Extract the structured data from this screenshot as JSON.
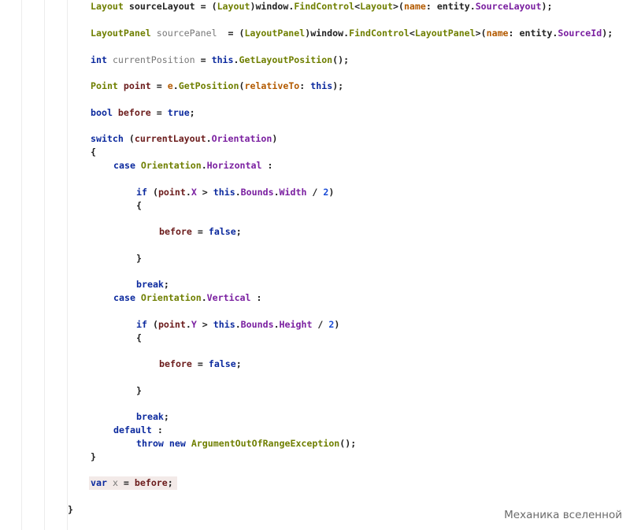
{
  "code_editor": {
    "lines": [
      [
        "Layout",
        " ",
        "sourceLayout",
        " = (",
        "Layout",
        ")",
        "window",
        ".",
        "FindControl",
        "<",
        "Layout",
        ">(",
        "name",
        ": ",
        "entity",
        ".",
        "SourceLayout",
        ");"
      ],
      [
        "LayoutPanel",
        " ",
        "sourcePanel",
        "  = (",
        "LayoutPanel",
        ")",
        "window",
        ".",
        "FindControl",
        "<",
        "LayoutPanel",
        ">(",
        "name",
        ": ",
        "entity",
        ".",
        "SourceId",
        ");"
      ],
      [
        "int",
        " ",
        "currentPosition",
        " = ",
        "this",
        ".",
        "GetLayoutPosition",
        "();"
      ],
      [
        "Point",
        " ",
        "point",
        " = ",
        "e",
        ".",
        "GetPosition",
        "(",
        "relativeTo",
        ": ",
        "this",
        ");"
      ],
      [
        "bool",
        " ",
        "before",
        " = ",
        "true",
        ";"
      ],
      [
        "switch",
        " (",
        "currentLayout",
        ".",
        "Orientation",
        ")"
      ],
      [
        "{"
      ],
      [
        "case",
        " ",
        "Orientation",
        ".",
        "Horizontal",
        " :"
      ],
      [
        "if",
        " (",
        "point",
        ".",
        "X",
        " > ",
        "this",
        ".",
        "Bounds",
        ".",
        "Width",
        " / ",
        "2",
        ")"
      ],
      [
        "{"
      ],
      [
        "before",
        " = ",
        "false",
        ";"
      ],
      [
        "}"
      ],
      [
        "break",
        ";"
      ],
      [
        "case",
        " ",
        "Orientation",
        ".",
        "Vertical",
        " :"
      ],
      [
        "if",
        " (",
        "point",
        ".",
        "Y",
        " > ",
        "this",
        ".",
        "Bounds",
        ".",
        "Height",
        " / ",
        "2",
        ")"
      ],
      [
        "{"
      ],
      [
        "before",
        " = ",
        "false",
        ";"
      ],
      [
        "}"
      ],
      [
        "break",
        ";"
      ],
      [
        "default",
        " :"
      ],
      [
        "throw",
        " ",
        "new",
        " ",
        "ArgumentOutOfRangeException",
        "();"
      ],
      [
        "}"
      ],
      [
        "var",
        " ",
        "x",
        " = ",
        "before",
        ";"
      ],
      [
        "}"
      ]
    ]
  },
  "watermark": {
    "text": "Механика вселенной"
  }
}
